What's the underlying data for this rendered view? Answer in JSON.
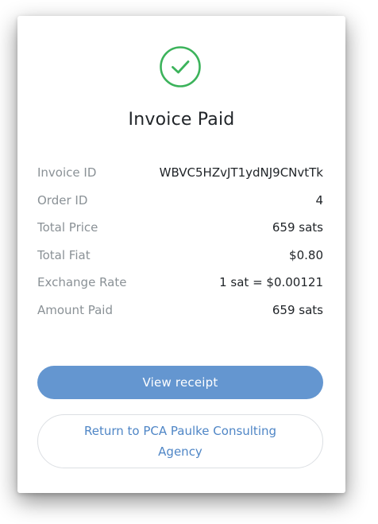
{
  "header": {
    "title": "Invoice Paid",
    "status_icon": "check-circle-icon",
    "accent_color": "#3cb35b"
  },
  "details": [
    {
      "label": "Invoice ID",
      "value": "WBVC5HZvJT1ydNJ9CNvtTk"
    },
    {
      "label": "Order ID",
      "value": "4"
    },
    {
      "label": "Total Price",
      "value": "659 sats"
    },
    {
      "label": "Total Fiat",
      "value": "$0.80"
    },
    {
      "label": "Exchange Rate",
      "value": "1 sat = $0.00121"
    },
    {
      "label": "Amount Paid",
      "value": "659 sats"
    }
  ],
  "actions": {
    "view_receipt_label": "View receipt",
    "return_label": "Return to PCA Paulke Consulting Agency",
    "primary_color": "#6496d0",
    "link_color": "#4f86c6"
  }
}
